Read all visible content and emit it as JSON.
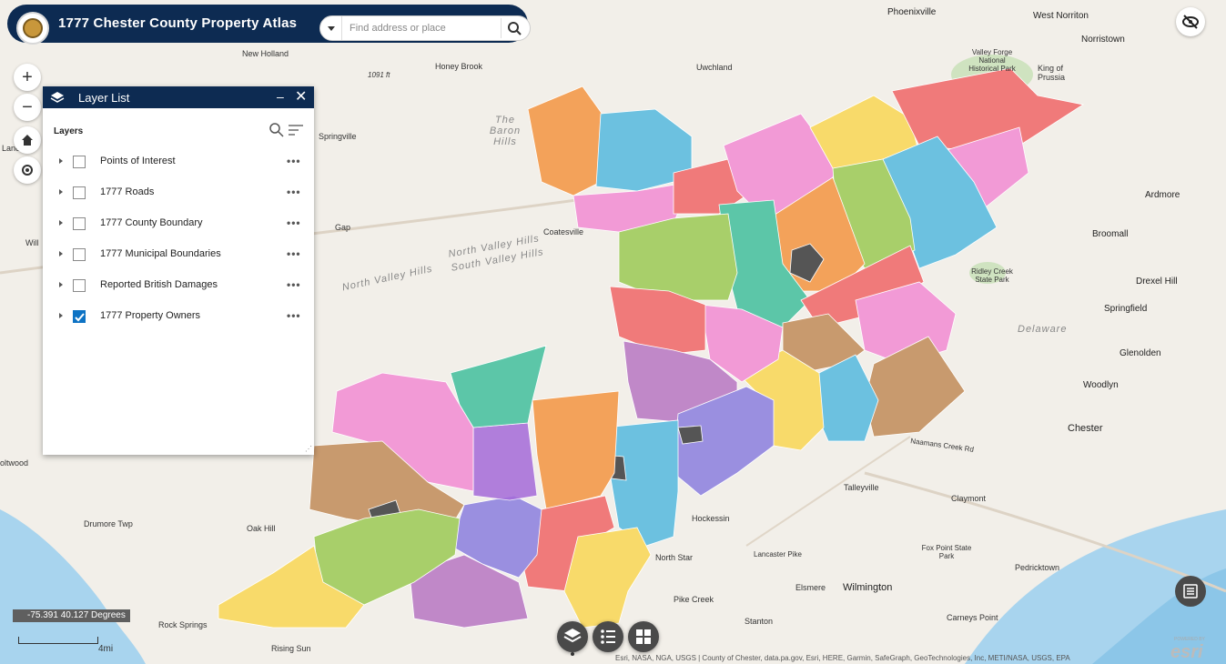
{
  "header": {
    "title": "1777 Chester County Property Atlas",
    "search_placeholder": "Find address or place"
  },
  "layer_panel": {
    "title": "Layer List",
    "section_label": "Layers",
    "layers": [
      {
        "label": "Points of Interest",
        "checked": false
      },
      {
        "label": "1777 Roads",
        "checked": false
      },
      {
        "label": "1777 County Boundary",
        "checked": false
      },
      {
        "label": "1777 Municipal Boundaries",
        "checked": false
      },
      {
        "label": "Reported British Damages",
        "checked": false
      },
      {
        "label": "1777 Property Owners",
        "checked": true
      }
    ],
    "more_label": "•••"
  },
  "map_labels": {
    "phoenixville": "Phoenixville",
    "west_norriton": "West Norriton",
    "norristown": "Norristown",
    "new_holland": "New Holland",
    "honey_brook": "Honey Brook",
    "uwchland": "Uwchland",
    "valley_forge": "Valley Forge National Historical Park",
    "king_of_prussia": "King of Prussia",
    "the_baron_hills": "The Baron Hills",
    "springville": "Springville",
    "gap": "Gap",
    "coatesville": "Coatesville",
    "south_valley_hills": "South Valley Hills",
    "north_valley_hills": "North Valley Hills",
    "north_valley_hills_2": "North Valley Hills",
    "ardmore": "Ardmore",
    "broomall": "Broomall",
    "ridley_creek": "Ridley Creek State Park",
    "drexel_hill": "Drexel Hill",
    "springfield": "Springfield",
    "delaware": "Delaware",
    "glenolden": "Glenolden",
    "woodlyn": "Woodlyn",
    "chester": "Chester",
    "naamans_creek": "Naamans Creek Rd",
    "talleyville": "Talleyville",
    "claymont": "Claymont",
    "hockessin": "Hockessin",
    "north_star": "North Star",
    "fox_point": "Fox Point State Park",
    "elsmere": "Elsmere",
    "wilmington": "Wilmington",
    "pike_creek": "Pike Creek",
    "pedricktown": "Pedricktown",
    "carneys_point": "Carneys Point",
    "stanton": "Stanton",
    "rising_sun": "Rising Sun",
    "rock_springs": "Rock Springs",
    "oak_hill": "Oak Hill",
    "drumore_twp": "Drumore Twp",
    "lancaster_pike": "Lancaster Pike",
    "ft1091": "1091 ft",
    "oltwood": "oltwood",
    "will": "Will",
    "lancaster": "Lancaste"
  },
  "coords_text": "-75.391 40.127 Degrees",
  "scale_text": "4mi",
  "attribution_text": "Esri, NASA, NGA, USGS | County of Chester, data.pa.gov, Esri, HERE, Garmin, SafeGraph, GeoTechnologies, Inc, METI/NASA, USGS, EPA",
  "esri_text": "esri",
  "powered_text": "POWERED BY",
  "colors": {
    "header_bg": "#0d2b52",
    "checkbox_on": "#0e73c4",
    "region_palette": [
      "#f3a25a",
      "#6cc1e0",
      "#f29ad6",
      "#a8cf6a",
      "#5cc6a8",
      "#f07a7a",
      "#f8da6a",
      "#c088c8",
      "#9a8fe0",
      "#c89a6e",
      "#555555"
    ]
  }
}
